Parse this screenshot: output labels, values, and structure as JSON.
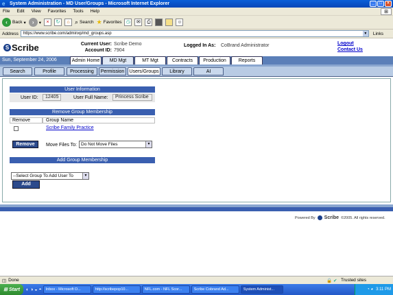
{
  "window": {
    "title": "System Administration - MD User/Groups - Microsoft Internet Explorer"
  },
  "menu": [
    "File",
    "Edit",
    "View",
    "Favorites",
    "Tools",
    "Help"
  ],
  "toolbar": {
    "back": "Back",
    "search": "Search",
    "favorites": "Favorites"
  },
  "address": {
    "label": "Address",
    "url": "https://www.scribe.com/adminxp/md_groups.asp",
    "links": "Links"
  },
  "header": {
    "logo": "Scribe",
    "current_user_label": "Current User:",
    "current_user": "Scribe Demo",
    "account_id_label": "Account ID:",
    "account_id": "7904",
    "logged_in_label": "Logged In As:",
    "logged_in_as": "CoBrand Administrator",
    "logout": "Logout",
    "contact": "Contact Us"
  },
  "date": "Sun, September 24, 2006",
  "main_tabs": [
    "Admin Home",
    "MD Mgt",
    "MT Mgt",
    "Contracts",
    "Production",
    "Reports"
  ],
  "sub_tabs": [
    "Search",
    "Profile",
    "Processing",
    "Permission",
    "Users/Groups",
    "Library",
    "AI"
  ],
  "user_info": {
    "header": "User Information",
    "user_id_label": "User ID:",
    "user_id": "12405",
    "full_name_label": "User Full Name:",
    "full_name": "Princess Scribe"
  },
  "remove_group": {
    "header": "Remove Group Membership",
    "col_remove": "Remove",
    "col_group": "Group Name",
    "groups": [
      "Scribe Family Practice"
    ],
    "remove_button": "Remove",
    "move_files_label": "Move Files To:",
    "move_files_value": "Do Not Move Files"
  },
  "add_group": {
    "header": "Add Group Membership",
    "select_value": "--Select Group To Add User To",
    "add_button": "Add"
  },
  "footer": {
    "powered_by": "Powered By",
    "brand": "Scribe",
    "copyright": "©2005. All rights reserved."
  },
  "status": {
    "text": "Done",
    "zone": "Trusted sites"
  },
  "taskbar": {
    "start": "Start",
    "tasks": [
      "Inbox - Microsoft O...",
      "http://scribepop10...",
      "NFL.com - NFL Scor...",
      "Scribe Cobrand Ad...",
      "System Administ..."
    ],
    "clock": "3:11 PM"
  }
}
